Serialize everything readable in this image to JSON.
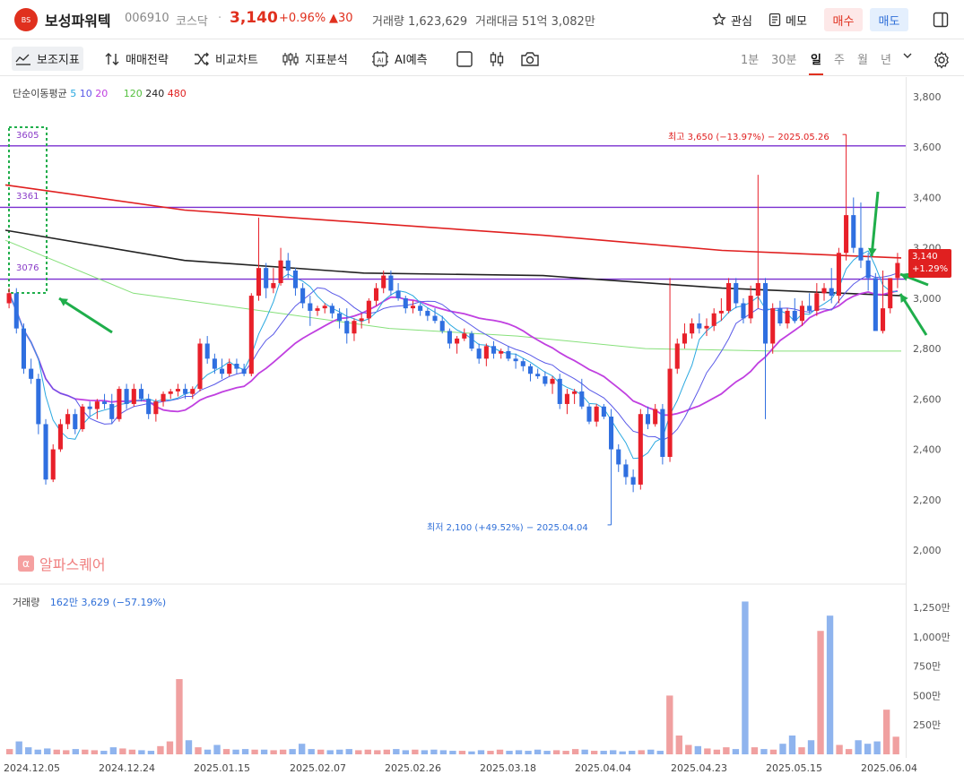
{
  "header": {
    "logo_text": "BS",
    "stock_name": "보성파워텍",
    "code": "006910",
    "market": "코스닥",
    "separator": "·",
    "price": "3,140",
    "change_pct": "+0.96%",
    "change_abs": "▲30",
    "volume_label": "거래량 1,623,629",
    "amount_label": "거래대금 51억 3,082만",
    "watch_label": "관심",
    "memo_label": "메모",
    "buy_label": "매수",
    "sell_label": "매도"
  },
  "toolbar": {
    "indicator_label": "보조지표",
    "strategy_label": "매매전략",
    "compare_label": "비교차트",
    "analysis_label": "지표분석",
    "ai_label": "AI예측",
    "periods": [
      "1분",
      "30분",
      "일",
      "주",
      "월",
      "년"
    ],
    "selected_period": "일"
  },
  "legend": {
    "ma_title": "단순이동평균",
    "ma_5": "5",
    "ma_10": "10",
    "ma_20": "20",
    "ma_120": "120",
    "ma_240": "240",
    "ma_480": "480",
    "colors": {
      "ma5": "#29a8e0",
      "ma10": "#5a5ae8",
      "ma20": "#c040e0",
      "ma120": "#86e07a",
      "ma240": "#222222",
      "ma480": "#e02020"
    }
  },
  "levels": [
    "3605",
    "3361",
    "3076"
  ],
  "annotations": {
    "high": "최고 3,650 (−13.97%) − 2025.05.26",
    "low": "최저 2,100 (+49.52%) − 2025.04.04",
    "watermark": "알파스퀘어",
    "current_price": "3,140",
    "current_pct": "+1.29%"
  },
  "volume_legend": {
    "title": "거래량",
    "value": "162만 3,629 (−57.19%)"
  },
  "y_axis": [
    "3,800",
    "3,600",
    "3,400",
    "3,200",
    "3,000",
    "2,800",
    "2,600",
    "2,400",
    "2,200",
    "2,000"
  ],
  "vol_axis": [
    "1,250만",
    "1,000만",
    "750만",
    "500만",
    "250만"
  ],
  "x_axis": [
    "2024.12.05",
    "2024.12.24",
    "2025.01.15",
    "2025.02.07",
    "2025.02.26",
    "2025.03.18",
    "2025.04.04",
    "2025.04.23",
    "2025.05.15",
    "2025.06.04"
  ],
  "chart_data": {
    "type": "candlestick",
    "title": "",
    "ylim": [
      2000,
      3800
    ],
    "volume_ylim": [
      0,
      1250
    ],
    "volume_unit": "만",
    "candles": [
      [
        2980,
        3040,
        2960,
        3020
      ],
      [
        3020,
        3040,
        2860,
        2880
      ],
      [
        2880,
        2900,
        2700,
        2720
      ],
      [
        2720,
        2760,
        2660,
        2680
      ],
      [
        2680,
        2700,
        2460,
        2500
      ],
      [
        2500,
        2520,
        2260,
        2280
      ],
      [
        2280,
        2420,
        2270,
        2400
      ],
      [
        2400,
        2520,
        2390,
        2500
      ],
      [
        2500,
        2560,
        2480,
        2540
      ],
      [
        2540,
        2560,
        2460,
        2480
      ],
      [
        2480,
        2580,
        2470,
        2570
      ],
      [
        2570,
        2590,
        2530,
        2560
      ],
      [
        2560,
        2600,
        2520,
        2590
      ],
      [
        2590,
        2620,
        2560,
        2580
      ],
      [
        2580,
        2620,
        2500,
        2520
      ],
      [
        2520,
        2650,
        2510,
        2640
      ],
      [
        2640,
        2660,
        2560,
        2580
      ],
      [
        2580,
        2660,
        2570,
        2640
      ],
      [
        2640,
        2660,
        2590,
        2600
      ],
      [
        2600,
        2620,
        2520,
        2540
      ],
      [
        2540,
        2600,
        2510,
        2590
      ],
      [
        2590,
        2630,
        2570,
        2620
      ],
      [
        2620,
        2640,
        2600,
        2630
      ],
      [
        2630,
        2660,
        2610,
        2640
      ],
      [
        2640,
        2660,
        2600,
        2620
      ],
      [
        2620,
        2650,
        2600,
        2640
      ],
      [
        2640,
        2840,
        2630,
        2820
      ],
      [
        2820,
        2850,
        2740,
        2760
      ],
      [
        2760,
        2780,
        2700,
        2720
      ],
      [
        2720,
        2760,
        2680,
        2700
      ],
      [
        2700,
        2760,
        2690,
        2740
      ],
      [
        2740,
        2760,
        2700,
        2720
      ],
      [
        2720,
        2740,
        2690,
        2700
      ],
      [
        2700,
        3020,
        2690,
        3010
      ],
      [
        3010,
        3320,
        2990,
        3120
      ],
      [
        3120,
        3140,
        3000,
        3040
      ],
      [
        3040,
        3120,
        3020,
        3060
      ],
      [
        3060,
        3200,
        3050,
        3150
      ],
      [
        3150,
        3180,
        3080,
        3110
      ],
      [
        3110,
        3120,
        3010,
        3040
      ],
      [
        3040,
        3060,
        2960,
        2980
      ],
      [
        2980,
        3010,
        2890,
        2950
      ],
      [
        2950,
        2970,
        2930,
        2960
      ],
      [
        2960,
        2980,
        2940,
        2970
      ],
      [
        2970,
        2980,
        2920,
        2940
      ],
      [
        2940,
        2960,
        2880,
        2910
      ],
      [
        2910,
        2960,
        2820,
        2860
      ],
      [
        2860,
        2920,
        2830,
        2910
      ],
      [
        2910,
        2940,
        2880,
        2920
      ],
      [
        2920,
        3000,
        2900,
        2990
      ],
      [
        2990,
        3060,
        2970,
        3040
      ],
      [
        3040,
        3110,
        3020,
        3090
      ],
      [
        3090,
        3110,
        3010,
        3030
      ],
      [
        3030,
        3060,
        2990,
        3000
      ],
      [
        3000,
        3010,
        2940,
        2960
      ],
      [
        2960,
        2990,
        2940,
        2970
      ],
      [
        2970,
        2980,
        2930,
        2950
      ],
      [
        2950,
        2960,
        2910,
        2930
      ],
      [
        2930,
        2960,
        2900,
        2910
      ],
      [
        2910,
        2930,
        2860,
        2870
      ],
      [
        2870,
        2880,
        2800,
        2820
      ],
      [
        2820,
        2850,
        2780,
        2840
      ],
      [
        2840,
        2880,
        2830,
        2860
      ],
      [
        2860,
        2870,
        2790,
        2800
      ],
      [
        2800,
        2820,
        2740,
        2760
      ],
      [
        2760,
        2820,
        2730,
        2810
      ],
      [
        2810,
        2830,
        2760,
        2780
      ],
      [
        2780,
        2800,
        2760,
        2790
      ],
      [
        2790,
        2810,
        2750,
        2760
      ],
      [
        2760,
        2780,
        2720,
        2750
      ],
      [
        2750,
        2760,
        2710,
        2730
      ],
      [
        2730,
        2740,
        2670,
        2700
      ],
      [
        2700,
        2720,
        2680,
        2690
      ],
      [
        2690,
        2710,
        2650,
        2660
      ],
      [
        2660,
        2690,
        2620,
        2680
      ],
      [
        2680,
        2700,
        2560,
        2580
      ],
      [
        2580,
        2640,
        2540,
        2620
      ],
      [
        2620,
        2640,
        2580,
        2630
      ],
      [
        2630,
        2680,
        2560,
        2570
      ],
      [
        2570,
        2580,
        2500,
        2510
      ],
      [
        2510,
        2580,
        2490,
        2570
      ],
      [
        2570,
        2580,
        2520,
        2530
      ],
      [
        2530,
        2560,
        2100,
        2400
      ],
      [
        2400,
        2420,
        2310,
        2340
      ],
      [
        2340,
        2360,
        2260,
        2290
      ],
      [
        2290,
        2320,
        2230,
        2260
      ],
      [
        2260,
        2560,
        2240,
        2540
      ],
      [
        2540,
        2570,
        2480,
        2500
      ],
      [
        2500,
        2580,
        2490,
        2560
      ],
      [
        2560,
        2580,
        2340,
        2370
      ],
      [
        2370,
        3080,
        2350,
        2720
      ],
      [
        2720,
        2840,
        2700,
        2820
      ],
      [
        2820,
        2900,
        2800,
        2860
      ],
      [
        2860,
        2920,
        2840,
        2900
      ],
      [
        2900,
        2940,
        2860,
        2880
      ],
      [
        2880,
        2920,
        2850,
        2890
      ],
      [
        2890,
        2960,
        2870,
        2940
      ],
      [
        2940,
        3000,
        2910,
        2950
      ],
      [
        2950,
        3080,
        2940,
        3060
      ],
      [
        3060,
        3080,
        2960,
        2980
      ],
      [
        2980,
        3000,
        2900,
        2920
      ],
      [
        2920,
        3050,
        2900,
        3010
      ],
      [
        3010,
        3490,
        2960,
        3060
      ],
      [
        3060,
        3080,
        2520,
        2820
      ],
      [
        2820,
        2980,
        2780,
        2960
      ],
      [
        2960,
        2990,
        2890,
        2900
      ],
      [
        2900,
        2960,
        2880,
        2950
      ],
      [
        2950,
        3000,
        2900,
        2910
      ],
      [
        2910,
        2990,
        2890,
        2970
      ],
      [
        2970,
        3020,
        2940,
        2950
      ],
      [
        2950,
        3060,
        2930,
        3020
      ],
      [
        3020,
        3060,
        2990,
        3040
      ],
      [
        3040,
        3120,
        2980,
        3010
      ],
      [
        3010,
        3200,
        2980,
        3180
      ],
      [
        3180,
        3650,
        3150,
        3330
      ],
      [
        3330,
        3400,
        3180,
        3200
      ],
      [
        3200,
        3380,
        3120,
        3150
      ],
      [
        3150,
        3180,
        3030,
        3080
      ],
      [
        3080,
        3100,
        2950,
        2870
      ],
      [
        2870,
        3110,
        2860,
        2960
      ],
      [
        2960,
        3080,
        2940,
        3080
      ],
      [
        3080,
        3180,
        3040,
        3140
      ]
    ],
    "ma5_sample": [
      3100,
      3000,
      2850,
      2700,
      2540,
      2480,
      2540,
      2600,
      2620,
      2700,
      2880,
      3050,
      2980,
      2930,
      2900,
      2800,
      2700,
      2600,
      2520,
      2420,
      2520,
      2800,
      2960,
      3020,
      3060,
      3200,
      3090
    ],
    "ma20_sample": [
      3000,
      2950,
      2800,
      2620,
      2560,
      2580,
      2700,
      2860,
      2950,
      2920,
      2850,
      2780,
      2700,
      2600,
      2560,
      2720,
      2880,
      2950,
      3000,
      3030
    ],
    "ma120": [
      3230,
      3020,
      2950,
      2880,
      2850,
      2800,
      2790,
      2790
    ],
    "ma240": [
      3270,
      3150,
      3100,
      3090,
      3040,
      3010
    ],
    "ma480": [
      3450,
      3350,
      3300,
      3250,
      3190,
      3160
    ],
    "volume": [
      45,
      110,
      60,
      40,
      50,
      40,
      35,
      45,
      40,
      35,
      30,
      60,
      50,
      40,
      35,
      30,
      70,
      110,
      640,
      120,
      60,
      40,
      80,
      45,
      40,
      45,
      40,
      40,
      35,
      40,
      45,
      90,
      45,
      40,
      35,
      40,
      45,
      35,
      40,
      35,
      40,
      45,
      35,
      40,
      35,
      40,
      35,
      30,
      30,
      25,
      35,
      30,
      40,
      30,
      35,
      30,
      40,
      30,
      35,
      30,
      45,
      40,
      30,
      30,
      35,
      25,
      30,
      35,
      40,
      30,
      500,
      160,
      80,
      70,
      50,
      40,
      60,
      45,
      1300,
      60,
      45,
      40,
      90,
      160,
      60,
      120,
      1050,
      1180,
      80,
      45,
      120,
      90,
      110,
      380,
      150
    ]
  }
}
